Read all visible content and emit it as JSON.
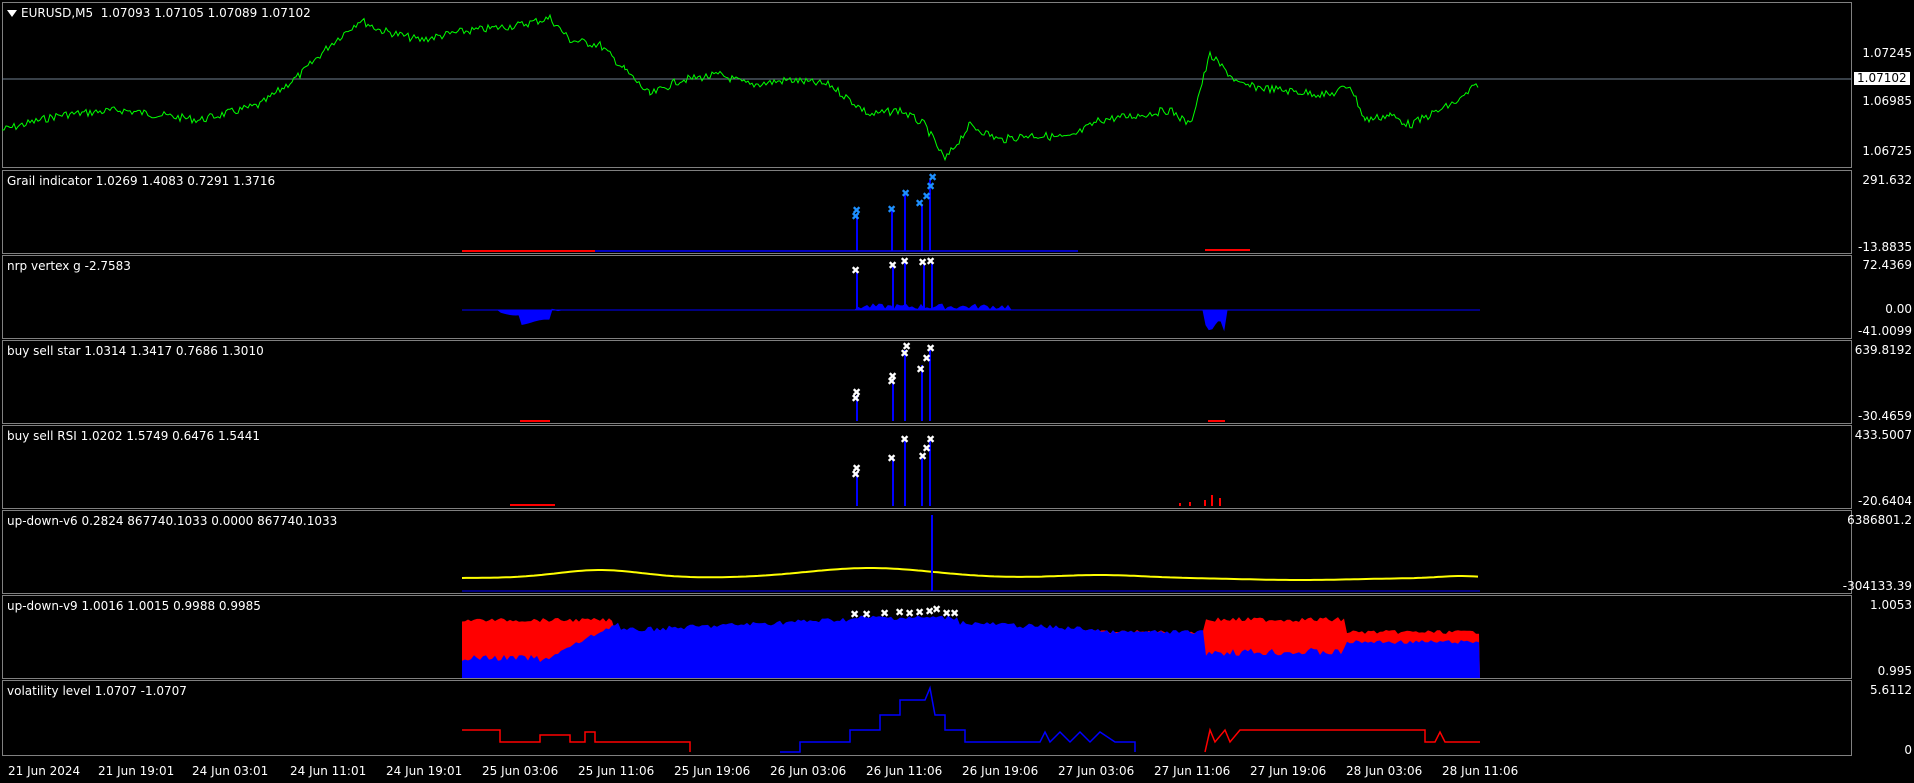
{
  "main": {
    "symbol": "EURUSD,M5",
    "ohlc": "1.07093 1.07105 1.07089 1.07102",
    "current_price": "1.07102",
    "ticks": [
      "1.07245",
      "1.06985",
      "1.06725"
    ],
    "line_color": "#00ff00"
  },
  "indicators": [
    {
      "label": "Grail indicator 1.0269 1.4083 0.7291 1.3716",
      "top": "291.632",
      "bottom": "-13.8835"
    },
    {
      "label": "nrp vertex g -2.7583",
      "top": "72.4369",
      "mid": "0.00",
      "bottom": "-41.0099"
    },
    {
      "label": "buy sell star 1.0314 1.3417 0.7686 1.3010",
      "top": "639.8192",
      "bottom": "-30.4659"
    },
    {
      "label": "buy sell RSI 1.0202 1.5749 0.6476 1.5441",
      "top": "433.5007",
      "bottom": "-20.6404"
    },
    {
      "label": "up-down-v6 0.2824 867740.1033 0.0000 867740.1033",
      "top": "6386801.2",
      "bottom": "-304133.39"
    },
    {
      "label": "up-down-v9 1.0016 1.0015 0.9988 0.9985",
      "top": "1.0053",
      "bottom": "0.995"
    },
    {
      "label": "volatility level 1.0707 -1.0707",
      "top": "5.6112",
      "bottom": "0"
    }
  ],
  "time_axis": [
    "21 Jun 2024",
    "21 Jun 19:01",
    "24 Jun 03:01",
    "24 Jun 11:01",
    "24 Jun 19:01",
    "25 Jun 03:06",
    "25 Jun 11:06",
    "25 Jun 19:06",
    "26 Jun 03:06",
    "26 Jun 11:06",
    "26 Jun 19:06",
    "27 Jun 03:06",
    "27 Jun 11:06",
    "27 Jun 19:06",
    "28 Jun 03:06",
    "28 Jun 11:06"
  ],
  "colors": {
    "up": "#0000ff",
    "down": "#ff0000",
    "signal": "#ffff00",
    "marker": "#ffffff",
    "marker_blue": "#1e90ff"
  }
}
